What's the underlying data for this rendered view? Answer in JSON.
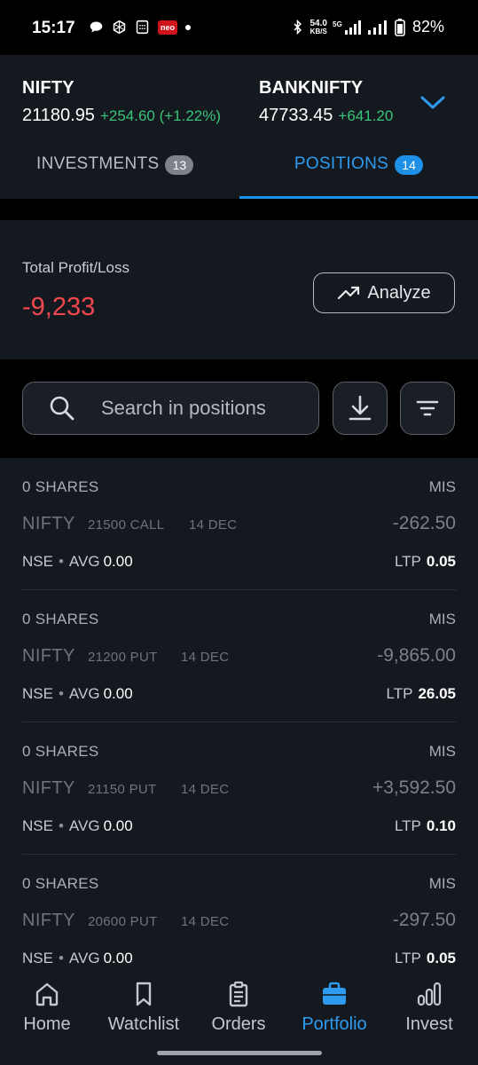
{
  "status_bar": {
    "time": "15:17",
    "net_speed_value": "54.0",
    "net_speed_unit": "KB/S",
    "battery": "82%",
    "neo_label": "neo"
  },
  "header": {
    "indices": [
      {
        "name": "NIFTY",
        "value": "21180.95",
        "change": "+254.60 (+1.22%)"
      },
      {
        "name": "BANKNIFTY",
        "value": "47733.45",
        "change": "+641.20"
      }
    ],
    "tabs": [
      {
        "label": "INVESTMENTS",
        "count": "13",
        "active": false
      },
      {
        "label": "POSITIONS",
        "count": "14",
        "active": true
      }
    ]
  },
  "pnl": {
    "label": "Total Profit/Loss",
    "value": "-9,233",
    "analyze_label": "Analyze"
  },
  "search": {
    "placeholder": "Search in positions"
  },
  "positions": [
    {
      "qty": "0 SHARES",
      "product": "MIS",
      "symbol": "NIFTY",
      "strike": "21500 CALL",
      "expiry": "14 DEC",
      "pl": "-262.50",
      "exchange": "NSE",
      "avg_label": "AVG",
      "avg": "0.00",
      "ltp_label": "LTP",
      "ltp": "0.05"
    },
    {
      "qty": "0 SHARES",
      "product": "MIS",
      "symbol": "NIFTY",
      "strike": "21200 PUT",
      "expiry": "14 DEC",
      "pl": "-9,865.00",
      "exchange": "NSE",
      "avg_label": "AVG",
      "avg": "0.00",
      "ltp_label": "LTP",
      "ltp": "26.05"
    },
    {
      "qty": "0 SHARES",
      "product": "MIS",
      "symbol": "NIFTY",
      "strike": "21150 PUT",
      "expiry": "14 DEC",
      "pl": "+3,592.50",
      "exchange": "NSE",
      "avg_label": "AVG",
      "avg": "0.00",
      "ltp_label": "LTP",
      "ltp": "0.10"
    },
    {
      "qty": "0 SHARES",
      "product": "MIS",
      "symbol": "NIFTY",
      "strike": "20600 PUT",
      "expiry": "14 DEC",
      "pl": "-297.50",
      "exchange": "NSE",
      "avg_label": "AVG",
      "avg": "0.00",
      "ltp_label": "LTP",
      "ltp": "0.05"
    }
  ],
  "bottom_nav": [
    {
      "label": "Home",
      "icon": "home-icon",
      "active": false
    },
    {
      "label": "Watchlist",
      "icon": "bookmark-icon",
      "active": false
    },
    {
      "label": "Orders",
      "icon": "clipboard-icon",
      "active": false
    },
    {
      "label": "Portfolio",
      "icon": "briefcase-icon",
      "active": true
    },
    {
      "label": "Invest",
      "icon": "bar-chart-icon",
      "active": false
    }
  ],
  "colors": {
    "accent": "#2d9cf0",
    "profit": "#39c47a",
    "loss": "#f0484f",
    "panel": "#14181f"
  }
}
